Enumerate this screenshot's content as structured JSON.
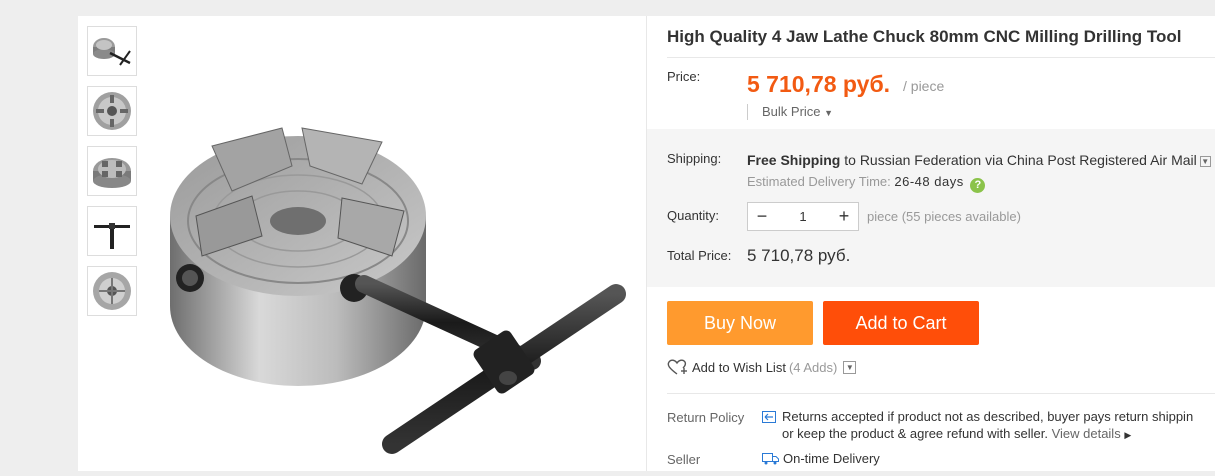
{
  "product": {
    "title": "High Quality 4 Jaw Lathe Chuck 80mm CNC Milling Drilling Tool"
  },
  "thumbnails": [
    {
      "icon": "chuck-with-key-thumbnail"
    },
    {
      "icon": "chuck-front-thumbnail"
    },
    {
      "icon": "chuck-angle-thumbnail"
    },
    {
      "icon": "chuck-key-thumbnail"
    },
    {
      "icon": "chuck-back-thumbnail"
    }
  ],
  "price": {
    "label": "Price:",
    "value": "5 710,78 руб.",
    "unit": "/ piece",
    "bulk_label": "Bulk Price",
    "accent_color": "#f25a12"
  },
  "shipping": {
    "label": "Shipping:",
    "free": "Free Shipping",
    "to": " to ",
    "destination": "Russian Federation via China Post Registered Air Mail",
    "est_label": "Estimated Delivery Time:",
    "est_days": "26-48 days",
    "help_icon": "?"
  },
  "quantity": {
    "label": "Quantity:",
    "minus": "−",
    "value": "1",
    "plus": "+",
    "available": "piece (55 pieces available)"
  },
  "total": {
    "label": "Total Price:",
    "value": "5 710,78 руб."
  },
  "actions": {
    "buy_now": "Buy Now",
    "add_to_cart": "Add to Cart",
    "buy_color": "#ff9a2e",
    "cart_color": "#ff4e09"
  },
  "wishlist": {
    "label": "Add to Wish List",
    "count": "(4 Adds)"
  },
  "return_policy": {
    "label": "Return Policy",
    "line1": "Returns accepted if product not as described, buyer pays return shippin",
    "line2": "or keep the product & agree refund with seller.",
    "link": "View details"
  },
  "seller": {
    "label": "Seller",
    "guarantee": "On-time Delivery"
  }
}
